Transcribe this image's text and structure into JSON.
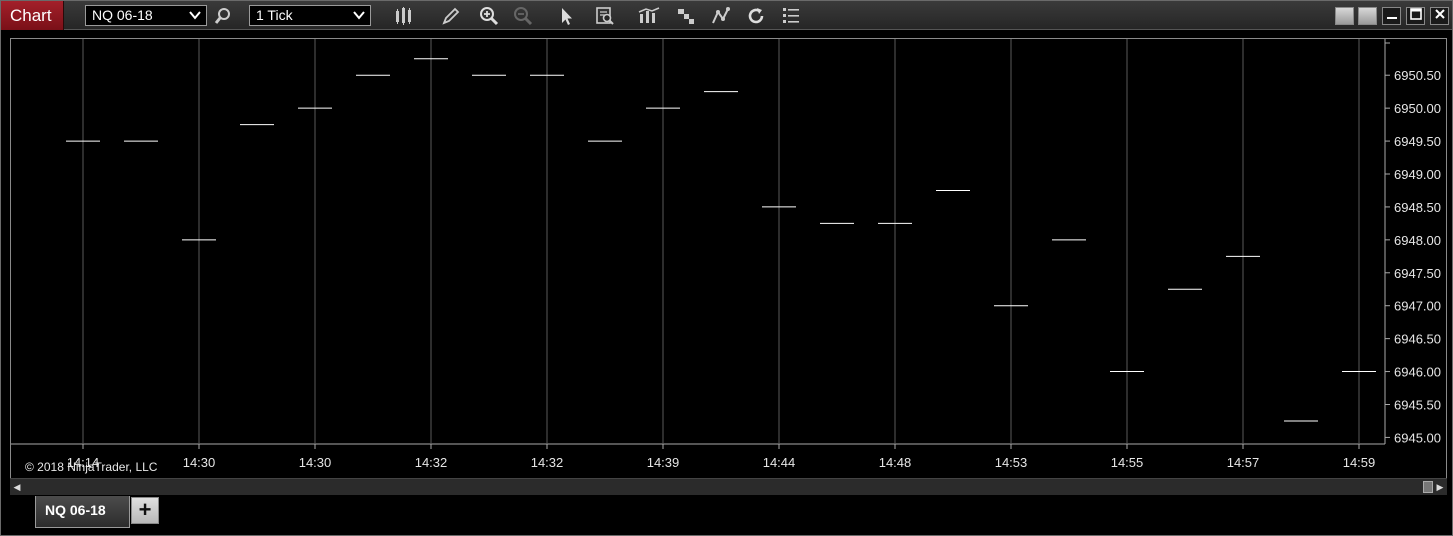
{
  "window": {
    "brand": "Chart",
    "instrument": "NQ 06-18",
    "interval": "1 Tick"
  },
  "toolbar_icons": [
    "bar-type-icon",
    "draw-pencil-icon",
    "zoom-in-icon",
    "zoom-out-icon",
    "pointer-icon",
    "data-box-icon",
    "indicators-icon",
    "strategies-icon",
    "drawing-tools-icon",
    "reload-icon",
    "properties-icon"
  ],
  "chart": {
    "copyright": "© 2018 NinjaTrader, LLC",
    "tab_label": "NQ 06-18",
    "add_tab_label": "+"
  },
  "colors": {
    "background": "#000000",
    "grid": "#5a5a5a",
    "price_bar": "#ffffff",
    "brand": "#8e1a22"
  },
  "chart_data": {
    "type": "line",
    "style": "tick-bars (flat horizontal tick marks)",
    "grid": true,
    "y_axis_side": "right",
    "ylim": [
      6944.9,
      6951.05
    ],
    "x_tick_labels": [
      "14:14",
      "14:30",
      "14:30",
      "14:32",
      "14:32",
      "14:39",
      "14:44",
      "14:48",
      "14:53",
      "14:55",
      "14:57",
      "14:59"
    ],
    "y_tick_labels": [
      "6950.50",
      "6950.00",
      "6949.50",
      "6949.00",
      "6948.50",
      "6948.00",
      "6947.50",
      "6947.00",
      "6946.50",
      "6946.00",
      "6945.50",
      "6945.00"
    ],
    "y_ticks": [
      6950.5,
      6950.0,
      6949.5,
      6949.0,
      6948.5,
      6948.0,
      6947.5,
      6947.0,
      6946.5,
      6946.0,
      6945.5,
      6945.0
    ],
    "series": [
      {
        "values": [
          6949.5,
          6949.5,
          6948.0,
          6949.75,
          6950.0,
          6950.5,
          6950.75,
          6950.5,
          6950.5,
          6949.5,
          6950.0,
          6950.25,
          6948.5,
          6948.25,
          6948.25,
          6948.75,
          6947.0,
          6948.0,
          6946.0,
          6947.25,
          6947.75,
          6945.25,
          6946.0
        ]
      }
    ]
  }
}
